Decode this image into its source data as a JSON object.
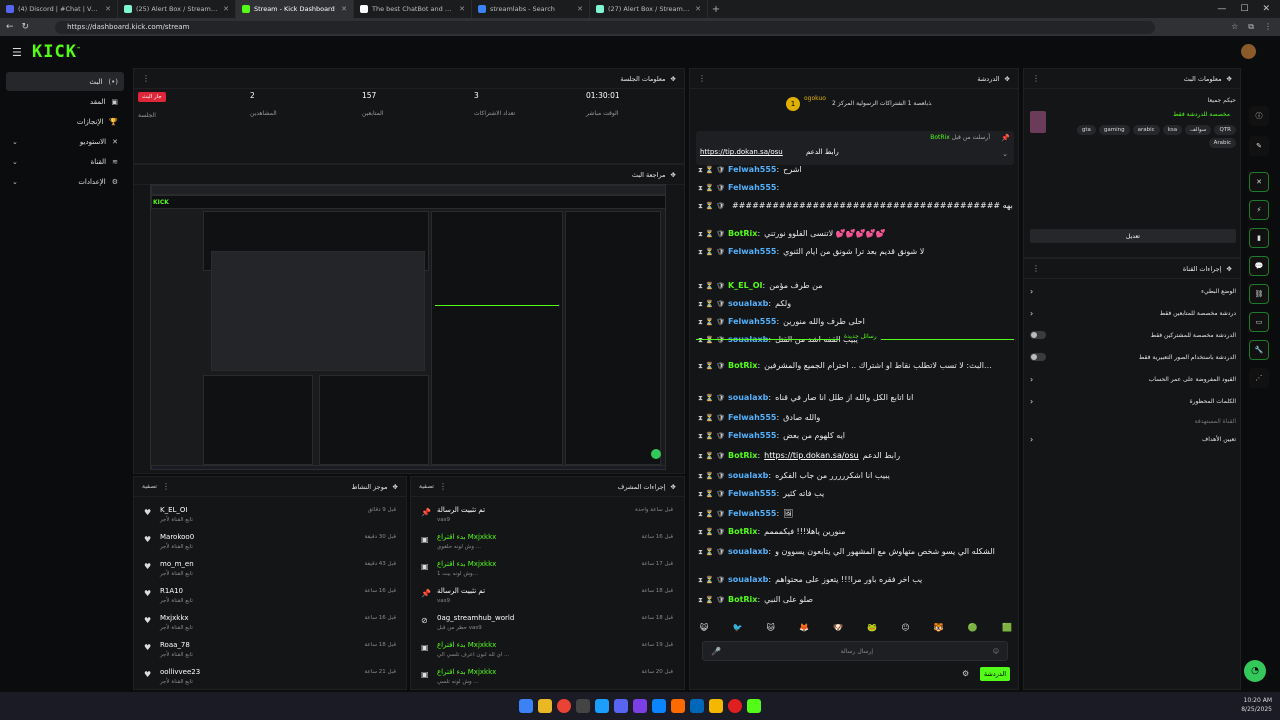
{
  "browser": {
    "tabs": [
      {
        "title": "(4) Discord | #Chat | Vas9",
        "fav": "#5865f2"
      },
      {
        "title": "(25) Alert Box / Streamlabs",
        "fav": "#80f5d2"
      },
      {
        "title": "Stream - Kick Dashboard",
        "fav": "#53fc18",
        "active": true
      },
      {
        "title": "The best ChatBot and Widgets fo",
        "fav": "#ffffff"
      },
      {
        "title": "streamlabs - Search",
        "fav": "#3b82f6"
      },
      {
        "title": "(27) Alert Box / Streamlabs",
        "fav": "#80f5d2"
      }
    ],
    "url": "https://dashboard.kick.com/stream"
  },
  "brand": {
    "logo": "KICK",
    "accent": "#53fc18"
  },
  "leftnav": [
    {
      "label": "البث",
      "icon": "(•)",
      "active": true
    },
    {
      "label": "المقد",
      "icon": "▣"
    },
    {
      "label": "الإنجازات",
      "icon": "🏆"
    },
    {
      "label": "الاستوديو",
      "icon": "✕",
      "expand": true
    },
    {
      "label": "القناة",
      "icon": "≋",
      "expand": true
    },
    {
      "label": "الإعدادات",
      "icon": "⚙",
      "expand": true
    }
  ],
  "session": {
    "title": "معلومات الجلسة",
    "badge": "جار البث",
    "badge_label": "الجلسة",
    "viewers": "2",
    "viewers_label": "المشاهدين",
    "followers": "157",
    "followers_label": "المتابعين",
    "subs": "3",
    "subs_label": "تعداد الاشتراكات",
    "time": "01:30:01",
    "time_label": "الوقت مباشر"
  },
  "preview": {
    "title": "مراجعة البث"
  },
  "activity": {
    "title": "موجز النشاط",
    "filter": "تصفية",
    "items": [
      {
        "name": "K_EL_OI",
        "sub": "تابع القناة لأجر",
        "time": "قبل 9 دقائق"
      },
      {
        "name": "Marokoo0",
        "sub": "تابع القناة لأجر",
        "time": "قبل 30 دقيقة"
      },
      {
        "name": "mo_m_en",
        "sub": "تابع القناة لأجر",
        "time": "قبل 43 دقيقة"
      },
      {
        "name": "R1A10",
        "sub": "تابع القناة لأجر",
        "time": "قبل 16 ساعة"
      },
      {
        "name": "Mxjxkkx",
        "sub": "تابع القناة لأجر",
        "time": "قبل 16 ساعة"
      },
      {
        "name": "Roaa_78",
        "sub": "تابع القناة لأجر",
        "time": "قبل 18 ساعة"
      },
      {
        "name": "oollivvee23",
        "sub": "تابع القناة لأجر",
        "time": "قبل 21 ساعة"
      }
    ]
  },
  "modactions": {
    "title": "إجراءات المشرف",
    "filter": "تصفية",
    "items": [
      {
        "icon": "📌",
        "name": "تم تثبيت الرسالة",
        "sub": "vas9",
        "time": "قبل ساعة واحدة"
      },
      {
        "icon": "▣",
        "name": "بدء اقتراع Mxjxkkx",
        "sub": "وش لونه حلقوي ...",
        "time": "قبل 16 ساعة",
        "green": true
      },
      {
        "icon": "▣",
        "name": "بدء اقتراع Mxjxkkx",
        "sub": "وش لونه بيت 1...",
        "time": "قبل 17 ساعة",
        "green": true
      },
      {
        "icon": "📌",
        "name": "تم تثبيت الرسالة",
        "sub": "vas9",
        "time": "قبل 18 ساعة"
      },
      {
        "icon": "⊘",
        "name": "0ag_streamhub_world",
        "sub": "حظر من قبل vas9",
        "time": "قبل 18 ساعة"
      },
      {
        "icon": "▣",
        "name": "بدء اقتراع Mxjxkkx",
        "sub": "اي لله لبون اعرف تلسي الي ...",
        "time": "قبل 19 ساعة",
        "green": true
      },
      {
        "icon": "▣",
        "name": "بدء اقتراع Mxjxkkx",
        "sub": "وش لونه تلسي ...",
        "time": "قبل 20 ساعة",
        "green": true
      }
    ]
  },
  "chat": {
    "title": "الدردشة",
    "top_user": "ogokuo",
    "top_user_rank": "1",
    "top_text": "ﺬﺑﺎﻌﺼﺔ 1 اﻟﺸﺘﺮاﻛﺎت اﻟﺮﺳﻮﻟﻴﺔ اﻟﻤﺮﻛﺰ 2",
    "pinned": {
      "by": "أرسلت من قبل",
      "user": "BotRix",
      "label": "رابط الدعم",
      "link": "https://tip.dokan.sa/osu"
    },
    "divider": "رسائل جديدة",
    "lines": [
      {
        "u": "Felwah555",
        "m": "اشرح"
      },
      {
        "u": "Felwah555",
        "m": ""
      },
      {
        "u": "",
        "m": "######################################## بهه"
      },
      {
        "u": "BotRix",
        "m": "لاتنسى الفلوو نورتني 💕💕💕💕💕",
        "bot": true
      },
      {
        "u": "Felwah555",
        "m": "لا شونق قديم بعد ترا شونق من ايام الثنوي"
      },
      {
        "u": "K_EL_OI",
        "m": "من طرف مؤمن",
        "bot": true
      },
      {
        "u": "soualaxb",
        "m": "ولكم"
      },
      {
        "u": "Felwah555",
        "m": "احلى طرف والله منورين"
      },
      {
        "u": "soualaxb",
        "m": "يبيب القفه اشد من القتل"
      },
      {
        "u": "BotRix",
        "m": "البث: لا تسب لاتطلب نقاط او اشتراك .. احترام الجميع والمشرفين...",
        "bot": true
      },
      {
        "u": "soualaxb",
        "m": "انا اتابع الكل والله از طلل انا صار في قناه"
      },
      {
        "u": "Felwah555",
        "m": "والله صادق"
      },
      {
        "u": "Felwah555",
        "m": "ايه كلهوم من بعض"
      },
      {
        "u": "BotRix",
        "m": "رابط الدعم",
        "link": "https://tip.dokan.sa/osu",
        "bot": true
      },
      {
        "u": "soualaxb",
        "m": "يبيب انا اشكررررر من جاب الفكره"
      },
      {
        "u": "Felwah555",
        "m": "يب فاته كثير"
      },
      {
        "u": "Felwah555",
        "m": "🖼"
      },
      {
        "u": "BotRix",
        "m": "منورين ياهلا!!! فيكمممم",
        "bot": true
      },
      {
        "u": "soualaxb",
        "m": "الشكله الي يسو شخص متهاوش مع المشهور الي يتابعون يسوون و"
      },
      {
        "u": "soualaxb",
        "m": "يب اخر فقره باور مرا!!! يتعوز على محتواهم"
      },
      {
        "u": "BotRix",
        "m": "صلو على النبي",
        "bot": true
      }
    ],
    "input_placeholder": "إرسال رسالة",
    "send_label": "الدردشة"
  },
  "stream_info": {
    "title": "معلومات البث",
    "stream_title": "حيكم جميعا",
    "category": "مخصصة للدردشة فقط",
    "tags": [
      "QTR",
      "سوالف",
      "ksa",
      "arabic",
      "gaming",
      "gta",
      "Arabic"
    ],
    "edit_label": "تعديل"
  },
  "channel_actions": {
    "title": "إجراءات القناة",
    "items": [
      {
        "label": "الوضع البطيء",
        "type": "chevron"
      },
      {
        "label": "دردشة مخصصة للمتابعين فقط",
        "type": "chevron"
      },
      {
        "label": "الدردشة مخصصة للمشتركين فقط",
        "type": "toggle"
      },
      {
        "label": "الدردشة باستخدام الصور التعبيرية فقط",
        "type": "toggle"
      },
      {
        "label": "القيود المفروضة على عمر الحساب",
        "type": "chevron"
      },
      {
        "label": "الكلمات المحظورة",
        "type": "chevron"
      },
      {
        "label": "القناة المستهدفة",
        "type": "none"
      },
      {
        "label": "تعيين الأهداف",
        "type": "chevron"
      }
    ]
  },
  "taskbar": {
    "time": "10:20 AM",
    "date": "8/25/2025"
  }
}
